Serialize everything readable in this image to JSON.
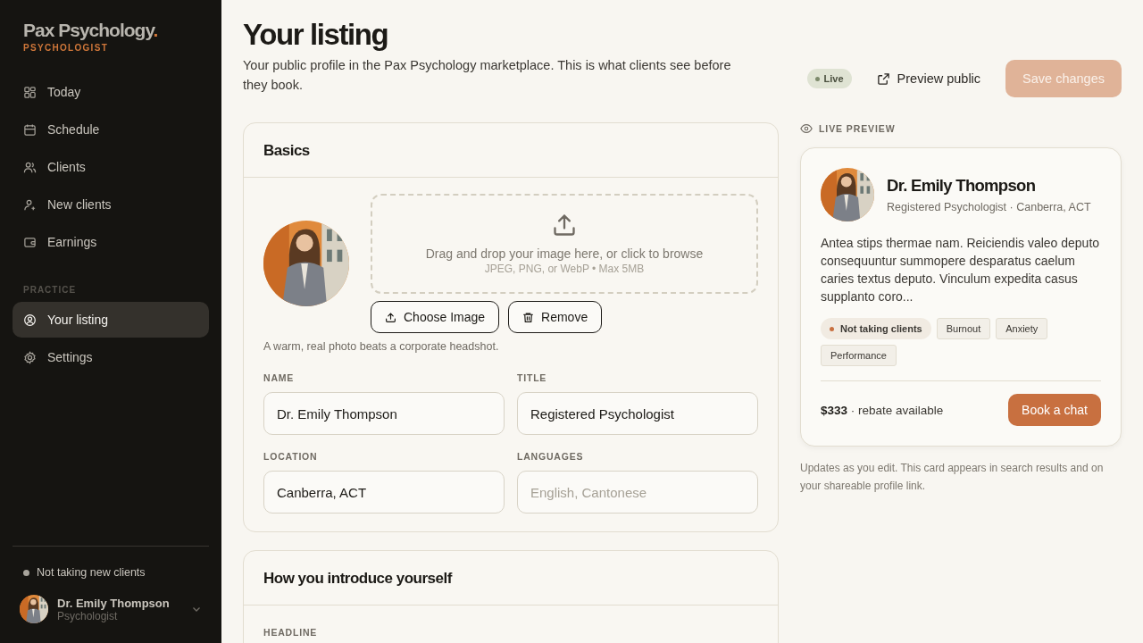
{
  "sidebar": {
    "logo": "Pax Psychology",
    "logo_mark": ".",
    "role": "PSYCHOLOGIST",
    "items": [
      {
        "label": "Today",
        "selected": false
      },
      {
        "label": "Schedule",
        "selected": false
      },
      {
        "label": "Clients",
        "selected": false
      },
      {
        "label": "New clients",
        "selected": false
      },
      {
        "label": "Earnings",
        "selected": false
      }
    ],
    "section": "PRACTICE",
    "section_items": [
      {
        "label": "Your listing",
        "selected": true
      },
      {
        "label": "Settings",
        "selected": false
      }
    ],
    "availability": {
      "label": "Not taking new clients",
      "color": "#a8a49c"
    },
    "user": {
      "name": "Dr. Emily Thompson",
      "role": "Psychologist"
    }
  },
  "header": {
    "title": "Your listing",
    "subtitle": "Your public profile in the Pax Psychology marketplace. This is what clients see before they book.",
    "status": {
      "label": "Live",
      "color": "#7d8a6c"
    },
    "preview_button": "Preview public",
    "save_button": {
      "label": "Save changes",
      "disabled": true
    }
  },
  "basics": {
    "title": "Basics",
    "dropzone": {
      "text": "Drag and drop your image here, or click to browse",
      "hint": "JPEG, PNG, or WebP • Max 5MB"
    },
    "choose_button": "Choose Image",
    "remove_button": "Remove",
    "photo_hint": "A warm, real photo beats a corporate headshot.",
    "fields": [
      {
        "label": "NAME",
        "value": "Dr. Emily Thompson"
      },
      {
        "label": "TITLE",
        "value": "Registered Psychologist"
      },
      {
        "label": "LOCATION",
        "value": "Canberra, ACT"
      },
      {
        "label": "LANGUAGES",
        "placeholder": "English, Cantonese"
      }
    ]
  },
  "intro": {
    "title": "How you introduce yourself",
    "first_label": "HEADLINE"
  },
  "preview": {
    "label": "LIVE PREVIEW",
    "name": "Dr. Emily Thompson",
    "meta": "Registered Psychologist · Canberra, ACT",
    "bio": "Antea stips thermae nam. Reiciendis valeo deputo consequuntur summopere desparatus caelum caries textus deputo. Vinculum expedita casus supplanto coro...",
    "tags": [
      {
        "kind": "status",
        "label": "Not taking clients",
        "color": "#c87040"
      },
      {
        "kind": "tag",
        "label": "Burnout"
      },
      {
        "kind": "tag",
        "label": "Anxiety"
      },
      {
        "kind": "tag",
        "label": "Performance"
      }
    ],
    "price": "$333",
    "price_note": " · rebate available",
    "book_button": "Book a chat",
    "footnote": "Updates as you edit. This card appears in search results and on your shareable profile link."
  }
}
